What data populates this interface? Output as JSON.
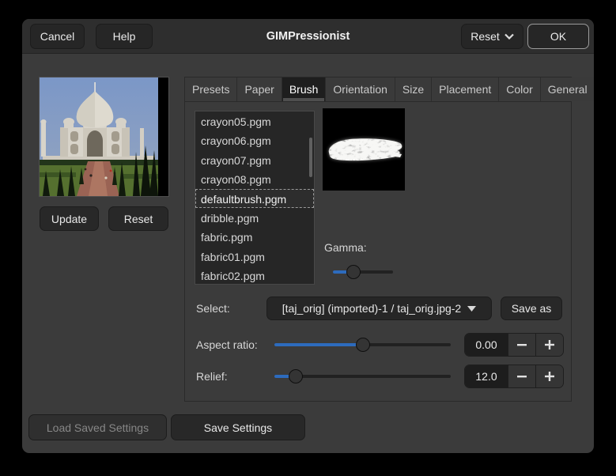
{
  "titlebar": {
    "cancel": "Cancel",
    "help": "Help",
    "title": "GIMPressionist",
    "reset": "Reset",
    "ok": "OK"
  },
  "preview_panel": {
    "update": "Update",
    "reset": "Reset"
  },
  "tabs": {
    "items": [
      "Presets",
      "Paper",
      "Brush",
      "Orientation",
      "Size",
      "Placement",
      "Color",
      "General"
    ],
    "active": "Brush"
  },
  "brush_tab": {
    "files": [
      "crayon05.pgm",
      "crayon06.pgm",
      "crayon07.pgm",
      "crayon08.pgm",
      "defaultbrush.pgm",
      "dribble.pgm",
      "fabric.pgm",
      "fabric01.pgm",
      "fabric02.pgm"
    ],
    "selected_file": "defaultbrush.pgm",
    "gamma": {
      "label": "Gamma:",
      "percent": 34
    },
    "select": {
      "label": "Select:",
      "value": "[taj_orig] (imported)-1 / taj_orig.jpg-2"
    },
    "save_as": "Save as",
    "aspect_ratio": {
      "label": "Aspect ratio:",
      "value": "0.00",
      "percent": 50
    },
    "relief": {
      "label": "Relief:",
      "value": "12.0",
      "percent": 12
    }
  },
  "footer": {
    "load": "Load Saved Settings",
    "load_disabled": true,
    "save": "Save Settings"
  },
  "colors": {
    "accent": "#2d6bbd",
    "titlebar_bg": "#2e2e2e",
    "dialog_bg": "#3b3b3b",
    "list_bg": "#262626",
    "active_tab_bg": "#1e1e1e"
  }
}
